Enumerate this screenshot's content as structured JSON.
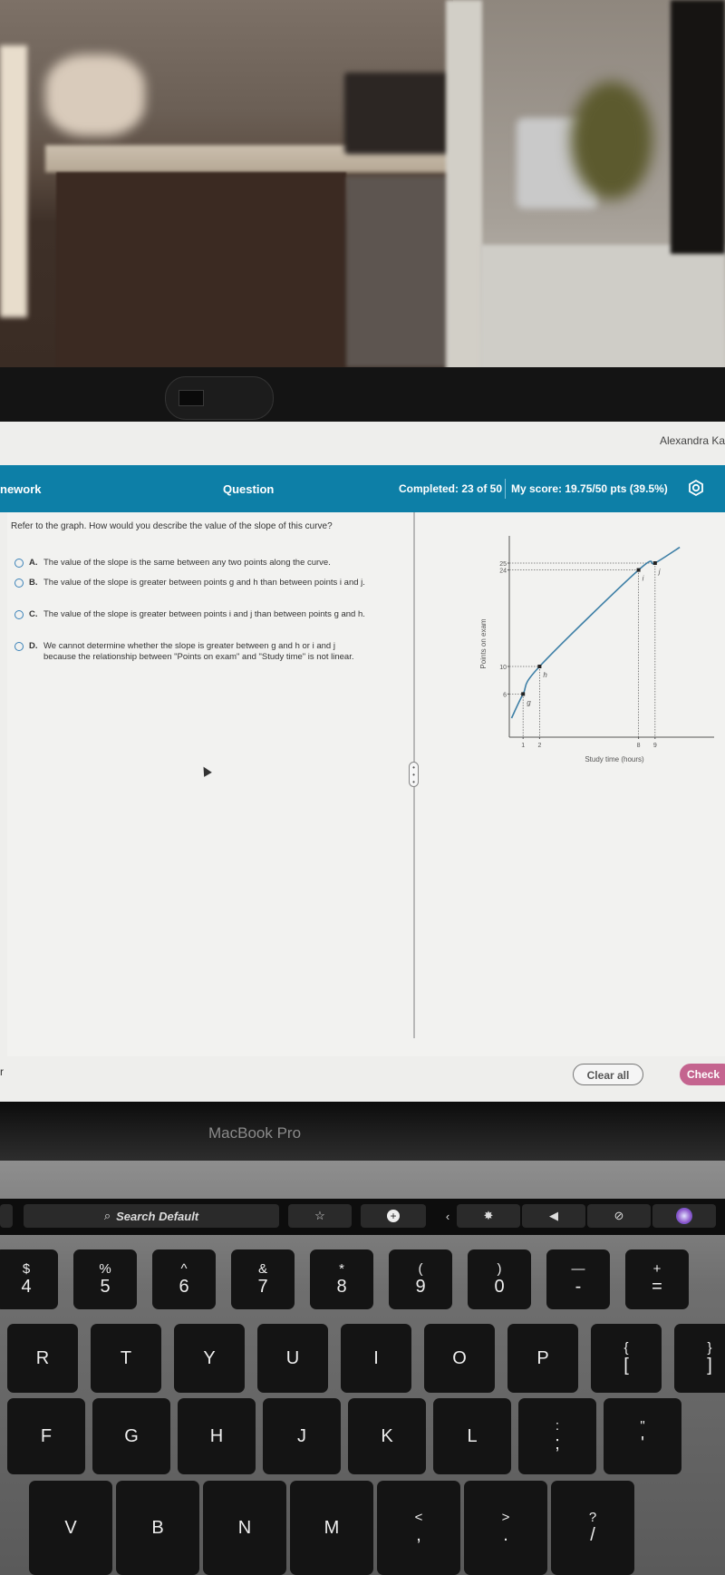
{
  "header": {
    "user_name": "Alexandra Ka",
    "section_label": "nework",
    "question_label": "Question",
    "completed": "Completed: 23 of 50",
    "score": "My score: 19.75/50 pts (39.5%)",
    "settings_icon": "gear-icon"
  },
  "question": {
    "prompt": "Refer to the graph.  How would you describe the value of the slope of this curve?",
    "options": [
      {
        "letter": "A.",
        "text": "The value of the slope is the same between any two points along the curve."
      },
      {
        "letter": "B.",
        "text": "The value of the slope is greater between points g and h than between points i and j."
      },
      {
        "letter": "C.",
        "text": "The value of the slope is greater between points i and j than between points g and h."
      },
      {
        "letter": "D.",
        "text": "We cannot determine whether the slope is greater between g and h or i and j because the relationship between \"Points on exam\" and \"Study time\" is not linear."
      }
    ]
  },
  "chart_data": {
    "type": "line",
    "title": "",
    "xlabel": "Study time (hours)",
    "ylabel": "Points on exam",
    "x_ticks": [
      "1",
      "2",
      "8",
      "9"
    ],
    "y_ticks": [
      "6",
      "10",
      "24",
      "25"
    ],
    "points": [
      {
        "label": "g",
        "x": 1,
        "y": 6
      },
      {
        "label": "h",
        "x": 2,
        "y": 10
      },
      {
        "label": "i",
        "x": 8,
        "y": 24
      },
      {
        "label": "j",
        "x": 9,
        "y": 25
      }
    ],
    "curve_color": "#3d7fa6",
    "grid": false
  },
  "footer": {
    "clear_all": "Clear all",
    "check": "Check",
    "left_mark": "r"
  },
  "laptop": {
    "brand_label": "MacBook Pro",
    "touchbar": {
      "search": "Search Default",
      "icons": [
        "bookmark-star-icon",
        "new-tab-plus-icon",
        "collapse-chevron-icon",
        "brightness-icon",
        "volume-icon",
        "mute-icon",
        "siri-icon"
      ]
    },
    "keys": {
      "number_row": [
        {
          "shift": "$",
          "main": "4"
        },
        {
          "shift": "%",
          "main": "5"
        },
        {
          "shift": "^",
          "main": "6"
        },
        {
          "shift": "&",
          "main": "7"
        },
        {
          "shift": "*",
          "main": "8"
        },
        {
          "shift": "(",
          "main": "9"
        },
        {
          "shift": ")",
          "main": "0"
        },
        {
          "shift": "—",
          "main": "-"
        },
        {
          "shift": "+",
          "main": "="
        }
      ],
      "top_row": [
        {
          "main": "R"
        },
        {
          "main": "T"
        },
        {
          "main": "Y"
        },
        {
          "main": "U"
        },
        {
          "main": "I"
        },
        {
          "main": "O"
        },
        {
          "main": "P"
        },
        {
          "shift": "{",
          "main": "["
        },
        {
          "shift": "}",
          "main": "]"
        }
      ],
      "home_row": [
        {
          "main": "F"
        },
        {
          "main": "G"
        },
        {
          "main": "H"
        },
        {
          "main": "J"
        },
        {
          "main": "K"
        },
        {
          "main": "L"
        },
        {
          "shift": ":",
          "main": ";"
        },
        {
          "shift": "\"",
          "main": "'"
        }
      ],
      "bottom_row": [
        {
          "main": "V"
        },
        {
          "main": "B"
        },
        {
          "main": "N"
        },
        {
          "main": "M"
        },
        {
          "shift": "<",
          "main": ","
        },
        {
          "shift": ">",
          "main": "."
        },
        {
          "shift": "?",
          "main": "/"
        }
      ]
    }
  }
}
